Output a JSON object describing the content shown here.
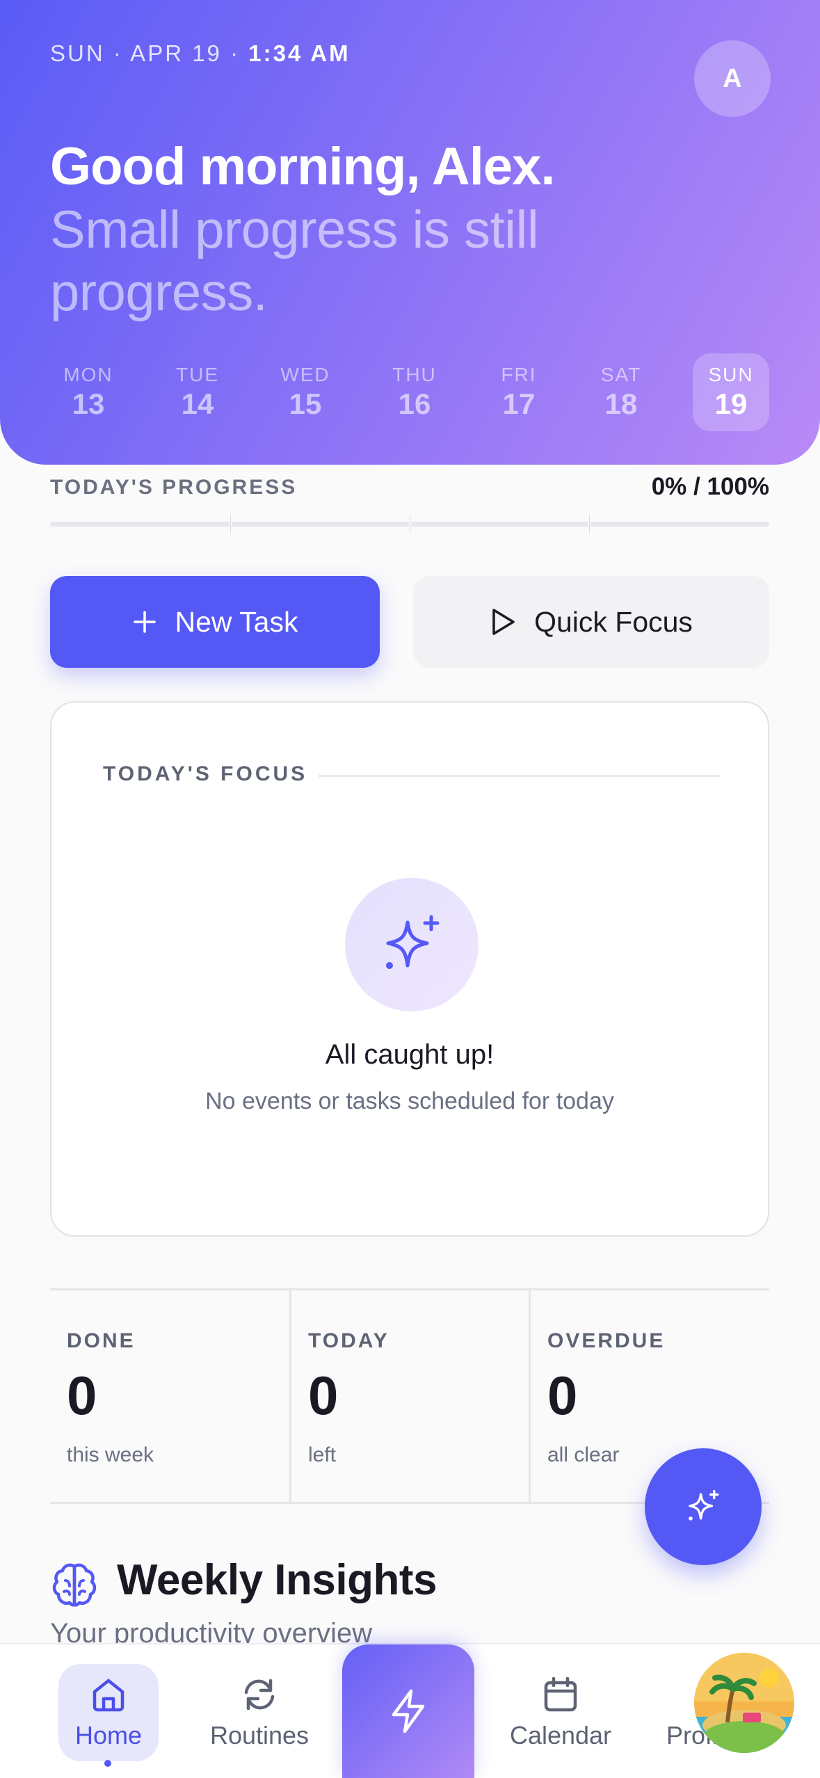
{
  "header": {
    "date": "SUN · APR 19 ·",
    "time": "1:34 AM",
    "avatar_initial": "A",
    "greeting": "Good morning, Alex.",
    "tagline": "Small progress is still progress."
  },
  "week": [
    {
      "name": "MON",
      "num": "13"
    },
    {
      "name": "TUE",
      "num": "14"
    },
    {
      "name": "WED",
      "num": "15"
    },
    {
      "name": "THU",
      "num": "16"
    },
    {
      "name": "FRI",
      "num": "17"
    },
    {
      "name": "SAT",
      "num": "18"
    },
    {
      "name": "SUN",
      "num": "19",
      "active": true
    }
  ],
  "progress": {
    "label": "TODAY'S PROGRESS",
    "value_text": "0% / 100%",
    "fraction": 0
  },
  "actions": {
    "new_task": "New Task",
    "quick_focus": "Quick Focus"
  },
  "focus": {
    "title": "TODAY'S FOCUS",
    "empty_title": "All caught up!",
    "empty_subtitle": "No events or tasks scheduled for today"
  },
  "stats": [
    {
      "label": "DONE",
      "value": "0",
      "sub": "this week"
    },
    {
      "label": "TODAY",
      "value": "0",
      "sub": "left"
    },
    {
      "label": "OVERDUE",
      "value": "0",
      "sub": "all clear"
    }
  ],
  "insights": {
    "title": "Weekly Insights",
    "subtitle": "Your productivity overview"
  },
  "tabs": {
    "home": "Home",
    "routines": "Routines",
    "calendar": "Calendar",
    "profile": "Profile"
  },
  "colors": {
    "accent": "#5458f4",
    "gradient_start": "#5a5cf6",
    "gradient_end": "#b88af6"
  }
}
